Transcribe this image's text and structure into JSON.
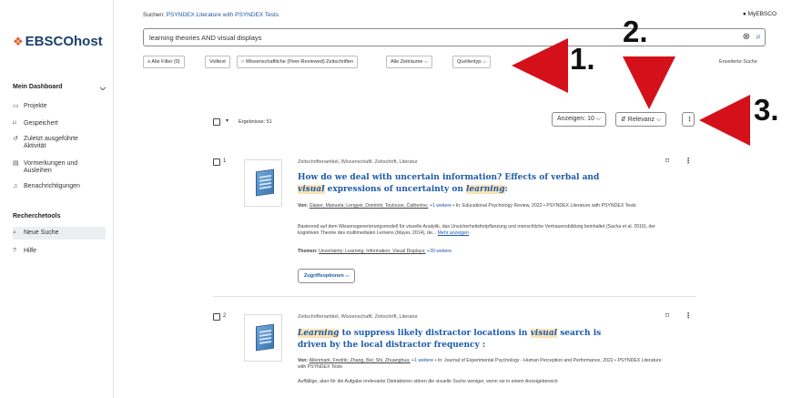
{
  "sidebar": {
    "logo_text": "EBSCOhost",
    "logo_mark": "❖",
    "dashboard_label": "Mein Dashboard",
    "items": [
      {
        "icon": "▭",
        "label": "Projekte"
      },
      {
        "icon": "⌑",
        "label": "Gespeichert"
      },
      {
        "icon": "↺",
        "label": "Zuletzt ausgeführte Aktivität"
      },
      {
        "icon": "▤",
        "label": "Vormerkungen und Ausleihen"
      },
      {
        "icon": "♫",
        "label": "Benachrichtigungen"
      }
    ],
    "tools_label": "Recherchetools",
    "tools": [
      {
        "icon": "⌕",
        "label": "Neue Suche"
      },
      {
        "icon": "?",
        "label": "Hilfe"
      }
    ]
  },
  "header": {
    "suchen_prefix": "Suchen:",
    "suchen_db": "PSYNDEX Literature with PSYNDEX Tests",
    "myebsco": "MyEBSCO",
    "query": "learning theories AND visual displays",
    "erweiterte": "Erweiterte Suche"
  },
  "filters": [
    {
      "label": "≡  Alle Filter (0)"
    },
    {
      "label": "Volltext"
    },
    {
      "label": "○  Wissenschaftliche (Peer-Reviewed) Zeitschriften"
    },
    {
      "label": "Alle Zeiträume  ⌵"
    },
    {
      "label": "Quellentyp  ⌵"
    }
  ],
  "controls": {
    "results": "Ergebnisse: 51",
    "show": "Anzeigen: 10  ⌵",
    "sort": "⇵ Relevanz  ⌵",
    "more": "⋮"
  },
  "annotations": [
    "1.",
    "2.",
    "3."
  ],
  "results": [
    {
      "num": "1",
      "meta": "Zeitschriftenartikel, Wissenschaftl. Zeitschrift, Literatur",
      "title_parts": [
        "How do we deal with uncertain information? Effects of verbal and ",
        "visual",
        " expressions of uncertainty on ",
        "learning",
        ":"
      ],
      "authors_prefix": "Von: ",
      "authors": "Glaser, Manuela; Lengyel, Dominik; Toulouse, Catherine;",
      "more": " +1 weitere",
      "source": " • In: Educational Psychology Review, 2022 • PSYNDEX Literature with PSYNDEX Tests",
      "abstract": "Basierend auf dem Wissensgenerierungsmodell für visuelle Analytik, das Unsicherheitsfortpflanzung und menschliche Vertrauensbildung beinhaltet (Sacha et al. 2016), der kognitiven Theorie des multimedialen Lernens (Mayer, 2014), de...",
      "abstract_more": "Mehr anzeigen",
      "themen_prefix": "Themen: ",
      "themen": "Uncertainty; Learning; Information; Visual Displays;",
      "themen_more": " +39 weitere",
      "access": "Zugriffsoptionen   ⌵"
    },
    {
      "num": "2",
      "meta": "Zeitschriftenartikel, Wissenschaftl. Zeitschrift, Literatur",
      "title_parts": [
        "Learning",
        " to suppress likely distractor locations in ",
        "visual",
        " search is driven by the local distractor frequency :"
      ],
      "authors_prefix": "Von: ",
      "authors": "Allenmark, Fredrik; Zhang, Bei; Shi, Zhuanghua;",
      "more": " +1 weitere",
      "source": " • In: Journal of Experimental Psychology - Human Perception and Performance, 2022 • PSYNDEX Literature with PSYNDEX Tests",
      "abstract": "Auffällige, aber für die Aufgabe irrelevante Distraktoren stören die visuelle Suche weniger, wenn sie in einem Anzeigebereich"
    }
  ]
}
